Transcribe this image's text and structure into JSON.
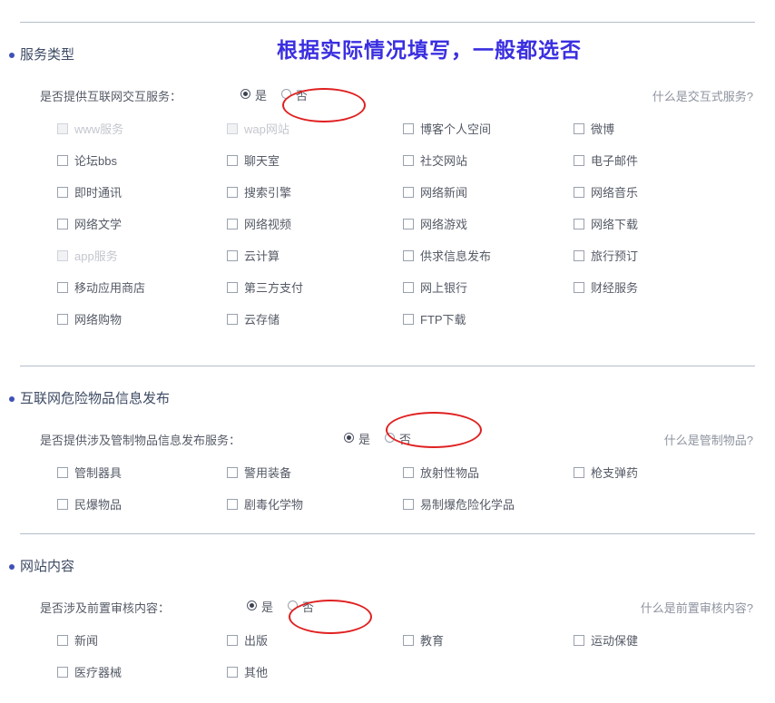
{
  "annotation": {
    "text": "根据实际情况填写，一般都选否",
    "color": "#3a2fe0"
  },
  "theme": {
    "accent": "#3f51b5",
    "heading": "#3d4a63",
    "text": "#555a66",
    "muted": "#8d939e",
    "disabled": "#c3c7ce",
    "marker": "#e02020",
    "divider": "#b4bdcb"
  },
  "sections": [
    {
      "id": "service-type",
      "title": "服务类型",
      "question": {
        "label": "是否提供互联网交互服务：",
        "options": [
          {
            "label": "是",
            "selected": true
          },
          {
            "label": "否",
            "selected": false
          }
        ],
        "marked_option": "否"
      },
      "help_link": "什么是交互式服务?",
      "checkbox_rows": [
        [
          {
            "label": "www服务",
            "checked": false,
            "disabled": true
          },
          {
            "label": "wap网站",
            "checked": false,
            "disabled": true
          },
          {
            "label": "博客个人空间",
            "checked": false,
            "disabled": false
          },
          {
            "label": "微博",
            "checked": false,
            "disabled": false
          }
        ],
        [
          {
            "label": "论坛bbs",
            "checked": false,
            "disabled": false
          },
          {
            "label": "聊天室",
            "checked": false,
            "disabled": false
          },
          {
            "label": "社交网站",
            "checked": false,
            "disabled": false
          },
          {
            "label": "电子邮件",
            "checked": false,
            "disabled": false
          }
        ],
        [
          {
            "label": "即时通讯",
            "checked": false,
            "disabled": false
          },
          {
            "label": "搜索引擎",
            "checked": false,
            "disabled": false
          },
          {
            "label": "网络新闻",
            "checked": false,
            "disabled": false
          },
          {
            "label": "网络音乐",
            "checked": false,
            "disabled": false
          }
        ],
        [
          {
            "label": "网络文学",
            "checked": false,
            "disabled": false
          },
          {
            "label": "网络视频",
            "checked": false,
            "disabled": false
          },
          {
            "label": "网络游戏",
            "checked": false,
            "disabled": false
          },
          {
            "label": "网络下载",
            "checked": false,
            "disabled": false
          }
        ],
        [
          {
            "label": "app服务",
            "checked": false,
            "disabled": true
          },
          {
            "label": "云计算",
            "checked": false,
            "disabled": false
          },
          {
            "label": "供求信息发布",
            "checked": false,
            "disabled": false
          },
          {
            "label": "旅行预订",
            "checked": false,
            "disabled": false
          }
        ],
        [
          {
            "label": "移动应用商店",
            "checked": false,
            "disabled": false
          },
          {
            "label": "第三方支付",
            "checked": false,
            "disabled": false
          },
          {
            "label": "网上银行",
            "checked": false,
            "disabled": false
          },
          {
            "label": "财经服务",
            "checked": false,
            "disabled": false
          }
        ],
        [
          {
            "label": "网络购物",
            "checked": false,
            "disabled": false
          },
          {
            "label": "云存储",
            "checked": false,
            "disabled": false
          },
          {
            "label": "FTP下载",
            "checked": false,
            "disabled": false
          }
        ]
      ]
    },
    {
      "id": "dangerous-goods",
      "title": "互联网危险物品信息发布",
      "question": {
        "label": "是否提供涉及管制物品信息发布服务：",
        "options": [
          {
            "label": "是",
            "selected": true
          },
          {
            "label": "否",
            "selected": false
          }
        ],
        "marked_option": "否"
      },
      "help_link": "什么是管制物品?",
      "checkbox_rows": [
        [
          {
            "label": "管制器具",
            "checked": false,
            "disabled": false
          },
          {
            "label": "警用装备",
            "checked": false,
            "disabled": false
          },
          {
            "label": "放射性物品",
            "checked": false,
            "disabled": false
          },
          {
            "label": "枪支弹药",
            "checked": false,
            "disabled": false
          }
        ],
        [
          {
            "label": "民爆物品",
            "checked": false,
            "disabled": false
          },
          {
            "label": "剧毒化学物",
            "checked": false,
            "disabled": false
          },
          {
            "label": "易制爆危险化学品",
            "checked": false,
            "disabled": false
          }
        ]
      ]
    },
    {
      "id": "site-content",
      "title": "网站内容",
      "question": {
        "label": "是否涉及前置审核内容：",
        "options": [
          {
            "label": "是",
            "selected": true
          },
          {
            "label": "否",
            "selected": false
          }
        ],
        "marked_option": "否"
      },
      "help_link": "什么是前置审核内容?",
      "checkbox_rows": [
        [
          {
            "label": "新闻",
            "checked": false,
            "disabled": false
          },
          {
            "label": "出版",
            "checked": false,
            "disabled": false
          },
          {
            "label": "教育",
            "checked": false,
            "disabled": false
          },
          {
            "label": "运动保健",
            "checked": false,
            "disabled": false
          }
        ],
        [
          {
            "label": "医疗器械",
            "checked": false,
            "disabled": false
          },
          {
            "label": "其他",
            "checked": false,
            "disabled": false
          }
        ]
      ]
    }
  ]
}
